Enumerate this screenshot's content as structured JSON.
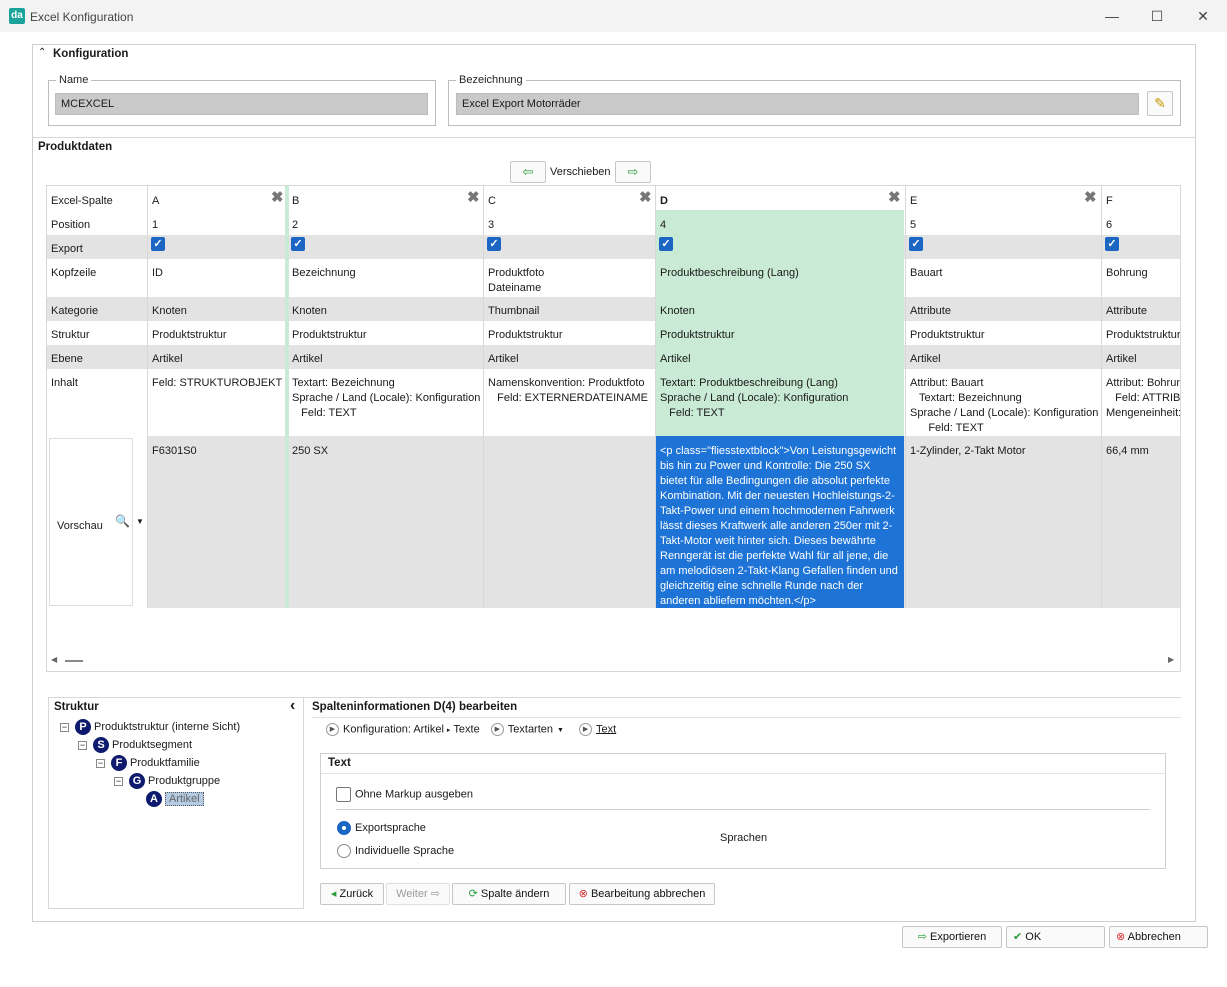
{
  "window": {
    "logo": "da",
    "title": "Excel Konfiguration",
    "min": "—",
    "max": "☐",
    "close": "✕"
  },
  "konfig": {
    "heading": "Konfiguration",
    "name_legend": "Name",
    "name_value": "MCEXCEL",
    "bez_legend": "Bezeichnung",
    "bez_value": "Excel Export Motorräder"
  },
  "produktdaten": {
    "heading": "Produktdaten",
    "move_label": "Verschieben"
  },
  "grid": {
    "row_labels": [
      "Excel-Spalte",
      "Position",
      "Export",
      "Kopfzeile",
      "Kategorie",
      "Struktur",
      "Ebene",
      "Inhalt",
      "Vorschau"
    ],
    "columns": [
      {
        "letter": "A",
        "position": "1",
        "kopf": [
          "ID",
          ""
        ],
        "kategorie": "Knoten",
        "struktur": "Produktstruktur",
        "ebene": "Artikel",
        "inhalt": [
          "Feld: STRUKTUROBJEKT",
          "",
          ""
        ],
        "vorschau": "F6301S0"
      },
      {
        "letter": "B",
        "position": "2",
        "kopf": [
          "Bezeichnung",
          ""
        ],
        "kategorie": "Knoten",
        "struktur": "Produktstruktur",
        "ebene": "Artikel",
        "inhalt": [
          "Textart: Bezeichnung",
          "Sprache / Land (Locale): Konfiguration",
          "   Feld: TEXT"
        ],
        "vorschau": "250 SX"
      },
      {
        "letter": "C",
        "position": "3",
        "kopf": [
          "Produktfoto",
          "Dateiname"
        ],
        "kategorie": "Thumbnail",
        "struktur": "Produktstruktur",
        "ebene": "Artikel",
        "inhalt": [
          "Namenskonvention: Produktfoto",
          "   Feld: EXTERNERDATEINAME",
          ""
        ],
        "vorschau": ""
      },
      {
        "letter": "D",
        "position": "4",
        "kopf": [
          "Produktbeschreibung (Lang)",
          ""
        ],
        "kategorie": "Knoten",
        "struktur": "Produktstruktur",
        "ebene": "Artikel",
        "inhalt": [
          "Textart: Produktbeschreibung (Lang)",
          "Sprache / Land (Locale): Konfiguration",
          "   Feld: TEXT"
        ],
        "vorschau": "<p class=\"fliesstextblock\">Von Leistungsgewicht bis hin zu Power und Kontrolle: Die 250 SX bietet für alle Bedingungen die absolut perfekte Kombination. Mit der neuesten Hochleistungs-2-Takt-Power und einem hochmodernen Fahrwerk lässt dieses Kraftwerk alle anderen 250er mit 2-Takt-Motor weit hinter sich. Dieses bewährte Renngerät ist die perfekte Wahl für all jene, die am melodiösen 2-Takt-Klang Gefallen finden und gleichzeitig eine schnelle Runde nach der anderen abliefern möchten.</p>"
      },
      {
        "letter": "E",
        "position": "5",
        "kopf": [
          "Bauart",
          ""
        ],
        "kategorie": "Attribute",
        "struktur": "Produktstruktur",
        "ebene": "Artikel",
        "inhalt": [
          "Attribut: Bauart",
          "   Textart: Bezeichnung",
          "Sprache / Land (Locale): Konfiguration",
          "      Feld: TEXT"
        ],
        "vorschau": "1-Zylinder, 2-Takt Motor"
      },
      {
        "letter": "F",
        "position": "6",
        "kopf": [
          "Bohrung",
          ""
        ],
        "kategorie": "Attribute",
        "struktur": "Produktstruktur",
        "ebene": "Artikel",
        "inhalt": [
          "Attribut: Bohrung",
          "   Feld: ATTRIB",
          "Mengeneinheit:"
        ],
        "vorschau": "66,4 mm"
      }
    ]
  },
  "struktur": {
    "heading": "Struktur",
    "collapse": "‹",
    "nodes": [
      {
        "badge": "P",
        "label": "Produktstruktur (interne Sicht)"
      },
      {
        "badge": "S",
        "label": "Produktsegment"
      },
      {
        "badge": "F",
        "label": "Produktfamilie"
      },
      {
        "badge": "G",
        "label": "Produktgruppe"
      },
      {
        "badge": "A",
        "label": "Artikel"
      }
    ]
  },
  "spalte": {
    "heading": "Spalteninformationen D(4) bearbeiten",
    "crumb": [
      "Konfiguration: Artikel",
      "Texte",
      "Textarten",
      "Text"
    ],
    "text_heading": "Text",
    "ohne_markup": "Ohne Markup ausgeben",
    "exportsprache": "Exportsprache",
    "individuell": "Individuelle Sprache",
    "sprachen": "Sprachen",
    "btn_zurueck": "Zurück",
    "btn_weiter": "Weiter",
    "btn_spalte": "Spalte ändern",
    "btn_abbrechen": "Bearbeitung abbrechen"
  },
  "footer": {
    "exportieren": "Exportieren",
    "ok": "OK",
    "abbrechen": "Abbrechen"
  }
}
